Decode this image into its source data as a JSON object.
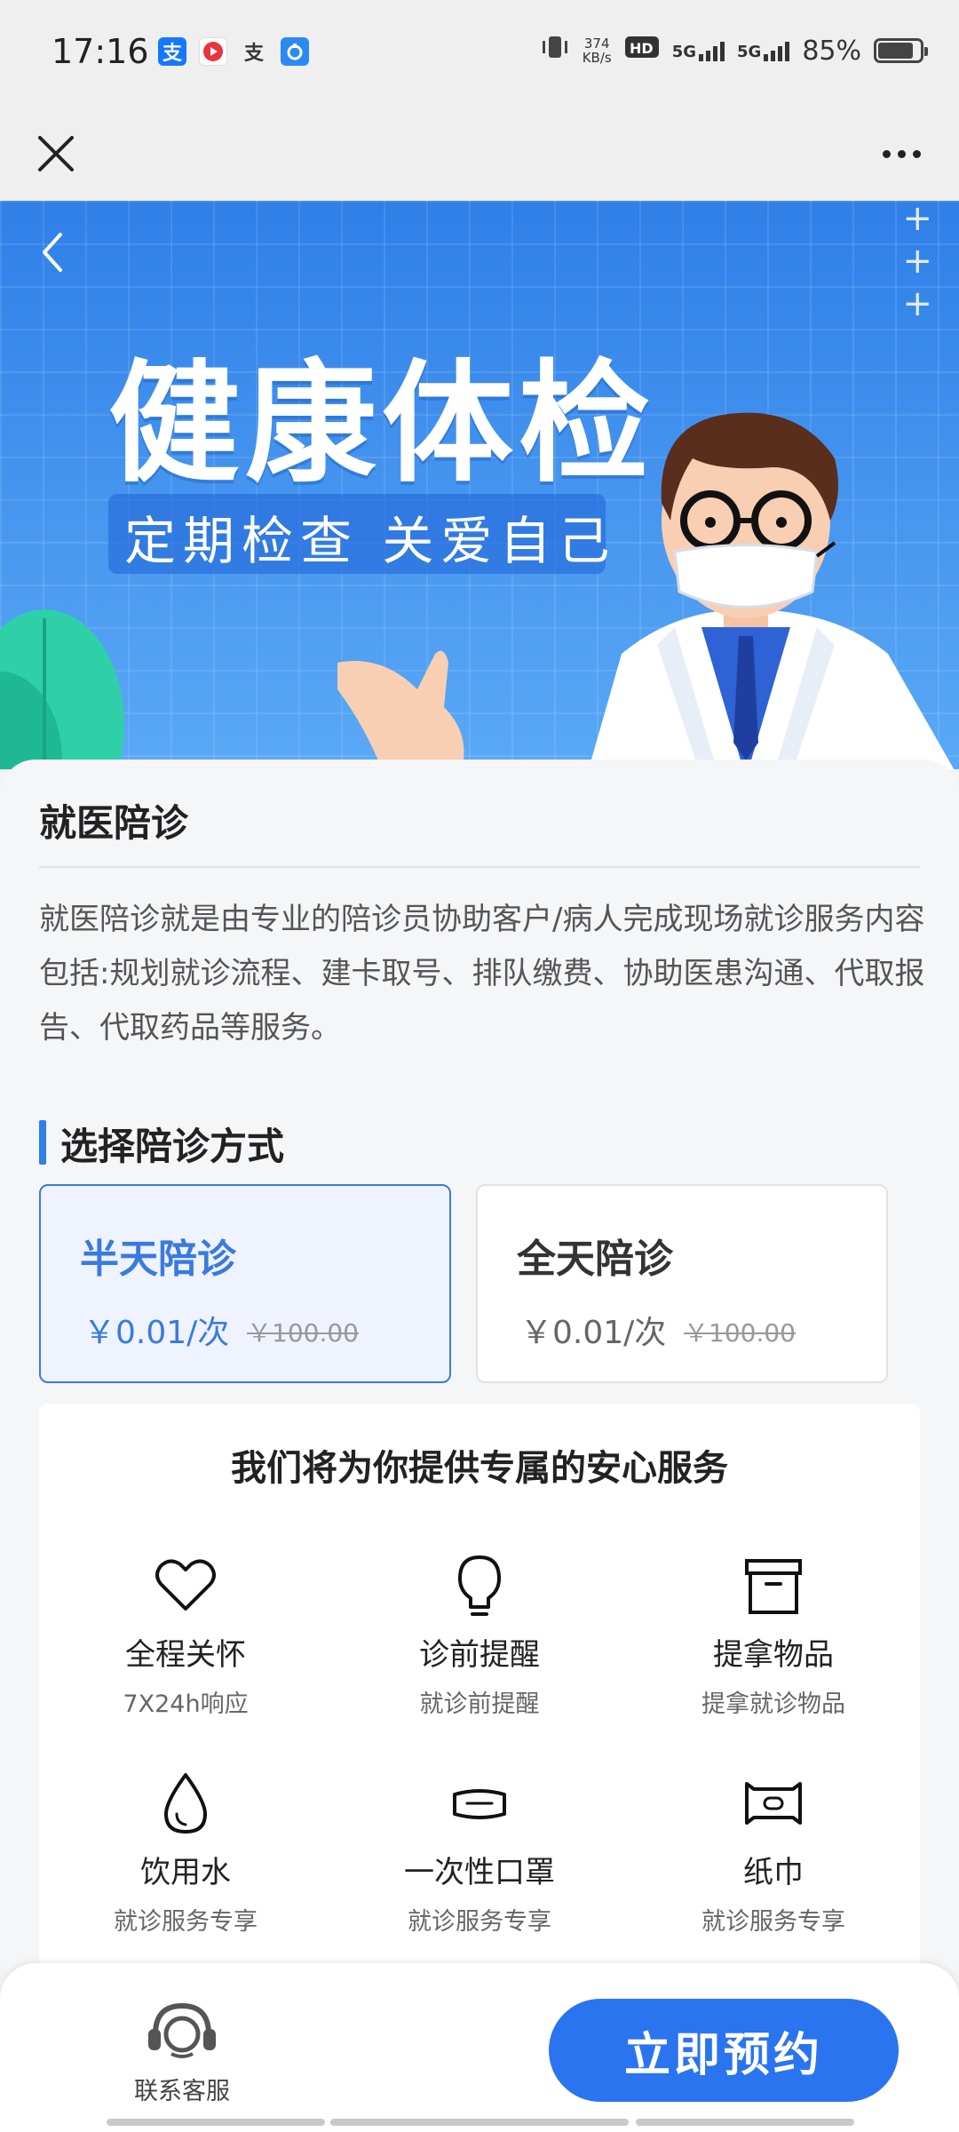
{
  "status_bar": {
    "time": "17:16",
    "net_speed_value": "374",
    "net_speed_unit": "KB/s",
    "network_1": "5G",
    "network_2": "5G",
    "battery": "85%",
    "battery_level": 0.85
  },
  "nav": {
    "close_icon": "close-icon",
    "more_icon": "more-icon"
  },
  "banner": {
    "title": "健康体检",
    "subtitle": "定期检查 关爱自己"
  },
  "intro": {
    "title": "就医陪诊",
    "description": "就医陪诊就是由专业的陪诊员协助客户/病人完成现场就诊服务内容包括:规划就诊流程、建卡取号、排队缴费、协助医患沟通、代取报告、代取药品等服务。"
  },
  "choose": {
    "title": "选择陪诊方式",
    "options": [
      {
        "title": "半天陪诊",
        "price": "￥0.01/次",
        "original_price": "￥100.00",
        "selected": true
      },
      {
        "title": "全天陪诊",
        "price": "￥0.01/次",
        "original_price": "￥100.00",
        "selected": false
      }
    ]
  },
  "services": {
    "title": "我们将为你提供专属的安心服务",
    "items": [
      {
        "icon": "heart-icon",
        "name": "全程关怀",
        "desc": "7X24h响应"
      },
      {
        "icon": "lightbulb-icon",
        "name": "诊前提醒",
        "desc": "就诊前提醒"
      },
      {
        "icon": "box-icon",
        "name": "提拿物品",
        "desc": "提拿就诊物品"
      },
      {
        "icon": "water-drop-icon",
        "name": "饮用水",
        "desc": "就诊服务专享"
      },
      {
        "icon": "mask-icon",
        "name": "一次性口罩",
        "desc": "就诊服务专享"
      },
      {
        "icon": "tissue-icon",
        "name": "纸巾",
        "desc": "就诊服务专享"
      }
    ]
  },
  "bottom": {
    "customer_service": "联系客服",
    "book_now": "立即预约"
  },
  "colors": {
    "accent": "#2b74ef",
    "selected_bg": "#eef3fd",
    "banner_blue": "#3a8ff0"
  }
}
